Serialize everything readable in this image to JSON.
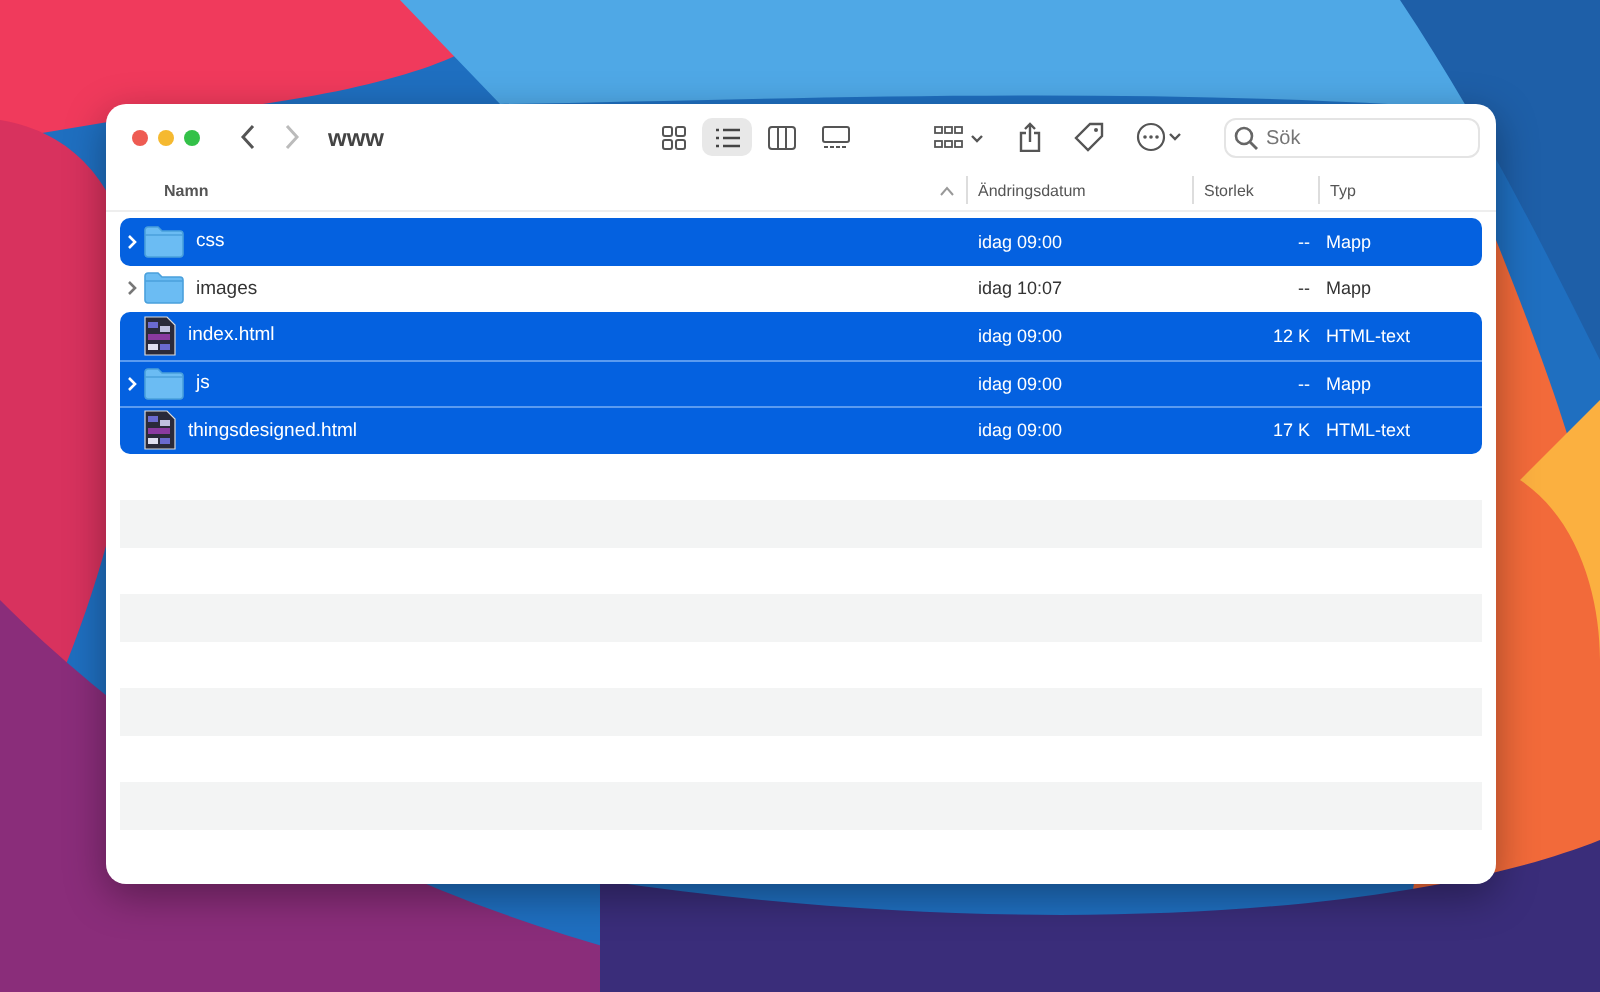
{
  "window": {
    "title": "www"
  },
  "toolbar": {
    "views": [
      {
        "kind": "icons",
        "selected": false
      },
      {
        "kind": "list",
        "selected": true
      },
      {
        "kind": "columns",
        "selected": false
      },
      {
        "kind": "gallery",
        "selected": false
      }
    ]
  },
  "search": {
    "placeholder": "Sök"
  },
  "table": {
    "columns": [
      "Namn",
      "Ändringsdatum",
      "Storlek",
      "Typ"
    ],
    "rows": [
      {
        "kind": "folder",
        "name": "css",
        "date": "idag 09:00",
        "size": "--",
        "type": "Mapp",
        "selected": true,
        "expanded": false
      },
      {
        "kind": "folder",
        "name": "images",
        "date": "idag 10:07",
        "size": "--",
        "type": "Mapp",
        "selected": false,
        "expanded": false
      },
      {
        "kind": "html",
        "name": "index.html",
        "date": "idag 09:00",
        "size": "12 K",
        "type": "HTML-text",
        "selected": true
      },
      {
        "kind": "folder",
        "name": "js",
        "date": "idag 09:00",
        "size": "--",
        "type": "Mapp",
        "selected": true,
        "expanded": false
      },
      {
        "kind": "html",
        "name": "thingsdesigned.html",
        "date": "idag 09:00",
        "size": "17 K",
        "type": "HTML-text",
        "selected": true
      }
    ]
  }
}
